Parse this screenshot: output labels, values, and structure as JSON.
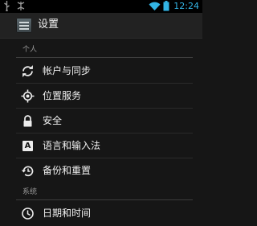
{
  "status_bar": {
    "time": "12:24",
    "icons": [
      "usb-icon",
      "usb-debug-icon",
      "wifi-icon",
      "battery-icon"
    ],
    "accent_color": "#33b5e5"
  },
  "action_bar": {
    "title": "设置",
    "icon": "settings-app-icon"
  },
  "sections": [
    {
      "header": "个人",
      "items": [
        {
          "label": "帐户与同步",
          "icon": "sync-icon"
        },
        {
          "label": "位置服务",
          "icon": "location-icon"
        },
        {
          "label": "安全",
          "icon": "lock-icon"
        },
        {
          "label": "语言和输入法",
          "icon": "keyboard-a-icon",
          "glyph": "A"
        },
        {
          "label": "备份和重置",
          "icon": "backup-restore-icon"
        }
      ]
    },
    {
      "header": "系统",
      "items": [
        {
          "label": "日期和时间",
          "icon": "clock-icon"
        }
      ]
    }
  ]
}
